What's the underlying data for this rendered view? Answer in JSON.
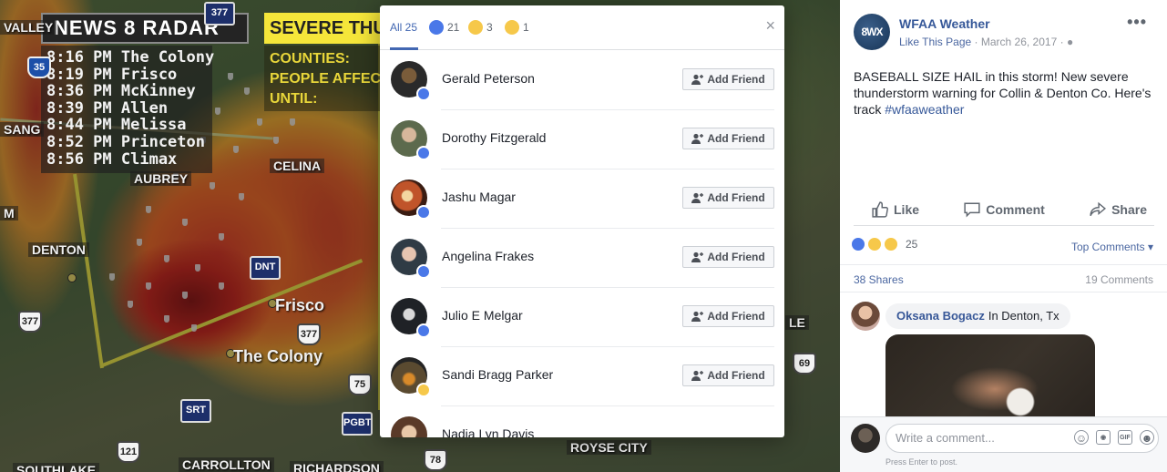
{
  "radar": {
    "brand": "NEWS 8 RADAR",
    "warning_title": "SEVERE THU",
    "times": [
      "8:16 PM The Colony",
      "8:19 PM Frisco",
      "8:36 PM McKinney",
      "8:39 PM Allen",
      "8:44 PM Melissa",
      "8:52 PM Princeton",
      "8:56 PM Climax"
    ],
    "warning_lines": [
      "COUNTIES:",
      "PEOPLE AFFEC",
      "UNTIL:"
    ],
    "places": {
      "valley": "VALLEY",
      "sang": "SANG",
      "aubrey": "AUBREY",
      "celina": "CELINA",
      "denton": "DENTON",
      "frisco": "Frisco",
      "the_colony": "The Colony",
      "carrollton": "CARROLLTON",
      "richardson": "RICHARDSON",
      "royse_city": "ROYSE CITY",
      "southlake": "SOUTHLAKE",
      "le": "LE",
      "m": "M"
    },
    "shields": {
      "i35": "35",
      "us377": "377",
      "us377b": "377",
      "sh121": "121",
      "sh75": "75",
      "sh69": "69",
      "tx78": "78"
    },
    "tolls": {
      "dnt": "DNT",
      "srt": "SRT",
      "pgbt": "PGBT",
      "top377": "377"
    }
  },
  "modal": {
    "tabs": [
      {
        "label": "All 25",
        "icon": "none"
      },
      {
        "label": "21",
        "icon": "like-icon"
      },
      {
        "label": "3",
        "icon": "wow-icon"
      },
      {
        "label": "1",
        "icon": "sad-icon"
      }
    ],
    "close": "×",
    "add_friend_label": "Add Friend",
    "people": [
      {
        "name": "Gerald Peterson",
        "reaction": "like"
      },
      {
        "name": "Dorothy Fitzgerald",
        "reaction": "like"
      },
      {
        "name": "Jashu Magar",
        "reaction": "like"
      },
      {
        "name": "Angelina Frakes",
        "reaction": "like"
      },
      {
        "name": "Julio E Melgar",
        "reaction": "like"
      },
      {
        "name": "Sandi Bragg Parker",
        "reaction": "wow"
      },
      {
        "name": "Nadia Lyn Davis",
        "reaction": "like"
      }
    ]
  },
  "post": {
    "page_name": "WFAA Weather",
    "avatar_text": "8WX",
    "like_page": "Like This Page",
    "date": "March 26, 2017",
    "more": "•••",
    "text": "BASEBALL SIZE HAIL in this storm! New severe thunderstorm warning for Collin & Denton Co. Here's track ",
    "hashtag": "#wfaaweather",
    "actions": {
      "like": "Like",
      "comment": "Comment",
      "share": "Share"
    },
    "reaction_count": "25",
    "top_comments": "Top Comments ▾",
    "shares": "38 Shares",
    "comments": "19 Comments",
    "comment": {
      "author": "Oksana Bogacz",
      "text": "In Denton, Tx"
    },
    "write_placeholder": "Write a comment...",
    "press_enter": "Press Enter to post.",
    "composer_icons": [
      "emoji-icon",
      "camera-icon",
      "gif-icon",
      "sticker-icon"
    ]
  },
  "colors": {
    "facebook_blue": "#4267b2",
    "link_blue": "#365899",
    "like_blue": "#4a78e8",
    "emoji_yellow": "#f6c84a"
  }
}
